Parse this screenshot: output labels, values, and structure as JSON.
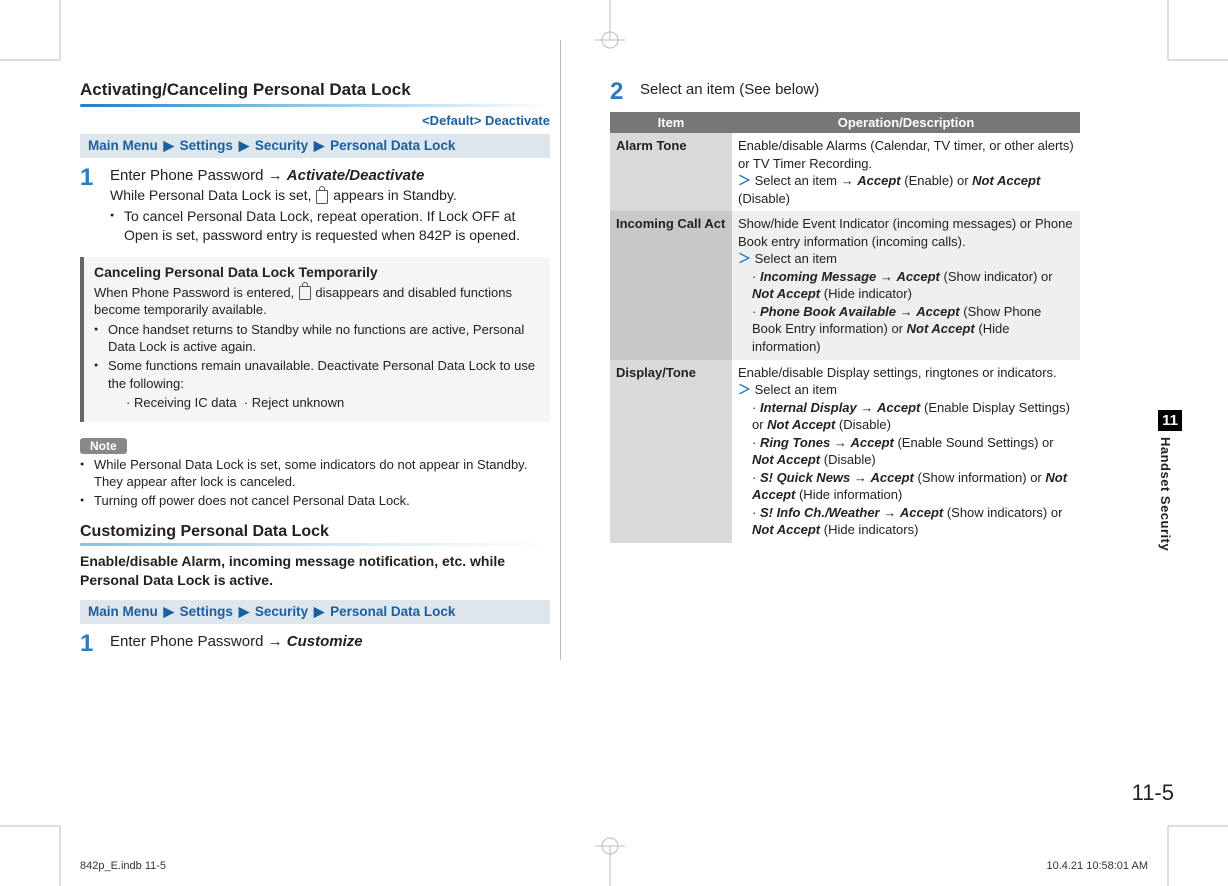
{
  "crop_marks": true,
  "left": {
    "section_title": "Activating/Canceling Personal Data Lock",
    "default_label": "<Default> Deactivate",
    "breadcrumb": [
      "Main Menu",
      "Settings",
      "Security",
      "Personal Data Lock"
    ],
    "step1": {
      "num": "1",
      "line_prefix": "Enter Phone Password ",
      "action": "Activate/Deactivate",
      "sub1_prefix": "While Personal Data Lock is set, ",
      "sub1_suffix": " appears in Standby.",
      "bullet1": "To cancel Personal Data Lock, repeat operation. If Lock OFF at Open is set, password entry is requested when 842P is opened."
    },
    "graybox": {
      "title": "Canceling Personal Data Lock Temporarily",
      "line1_prefix": "When Phone Password is entered, ",
      "line1_suffix": " disappears and disabled functions become temporarily available.",
      "bullet1": "Once handset returns to Standby while no functions are active, Personal Data Lock is active again.",
      "bullet2": "Some functions remain unavailable. Deactivate Personal Data Lock to use the following:",
      "sub_a": "Receiving IC data",
      "sub_b": "Reject unknown"
    },
    "note_label": "Note",
    "note_bullets": [
      "While Personal Data Lock is set, some indicators do not appear in Standby. They appear after lock is canceled.",
      "Turning off power does not cancel Personal Data Lock."
    ],
    "subsection_title": "Customizing Personal Data Lock",
    "intro": "Enable/disable Alarm, incoming message notification, etc. while Personal Data Lock is active.",
    "breadcrumb2": [
      "Main Menu",
      "Settings",
      "Security",
      "Personal Data Lock"
    ],
    "step_c1": {
      "num": "1",
      "line_prefix": "Enter Phone Password ",
      "action": "Customize"
    }
  },
  "right": {
    "step2_num": "2",
    "step2_text": "Select an item (See below)",
    "table_headers": [
      "Item",
      "Operation/Description"
    ],
    "rows": [
      {
        "item": "Alarm Tone",
        "desc_line1": "Enable/disable Alarms (Calendar, TV timer, or other alerts) or TV Timer Recording.",
        "gt_prefix": "Select an item ",
        "accept_label": "Accept",
        "accept_paren": " (Enable) or ",
        "notaccept_label": "Not Accept",
        "notaccept_paren": " (Disable)"
      },
      {
        "item": "Incoming Call Act",
        "desc_line1": "Show/hide Event Indicator (incoming messages) or Phone Book entry information (incoming calls).",
        "gt_text": "Select an item",
        "sub_items": [
          {
            "name": "Incoming Message",
            "accept_paren": " (Show indicator) or ",
            "notaccept_paren": " (Hide indicator)"
          },
          {
            "name": "Phone Book Available",
            "accept_paren": " (Show Phone Book Entry information) or ",
            "notaccept_paren": " (Hide information)"
          }
        ]
      },
      {
        "item": "Display/Tone",
        "desc_line1": "Enable/disable Display settings, ringtones or indicators.",
        "gt_text": "Select an item",
        "sub_items": [
          {
            "name": "Internal Display",
            "accept_paren": " (Enable Display Settings) or ",
            "notaccept_paren": " (Disable)"
          },
          {
            "name": "Ring Tones",
            "accept_paren": " (Enable Sound Settings) or ",
            "notaccept_paren": " (Disable)"
          },
          {
            "name": "S! Quick News",
            "accept_paren": " (Show information) or ",
            "notaccept_paren": " (Hide information)"
          },
          {
            "name": "S! Info Ch./Weather",
            "accept_paren": " (Show indicators) or ",
            "notaccept_paren": " (Hide indicators)"
          }
        ]
      }
    ]
  },
  "side_tab": {
    "num": "11",
    "name": "Handset Security"
  },
  "page_number": "11-5",
  "footer": {
    "left": "842p_E.indb   11-5",
    "right": "10.4.21   10:58:01 AM"
  },
  "labels": {
    "accept": "Accept",
    "not_accept": "Not Accept",
    "arrow": "→",
    "bc_arrow": "▶"
  }
}
